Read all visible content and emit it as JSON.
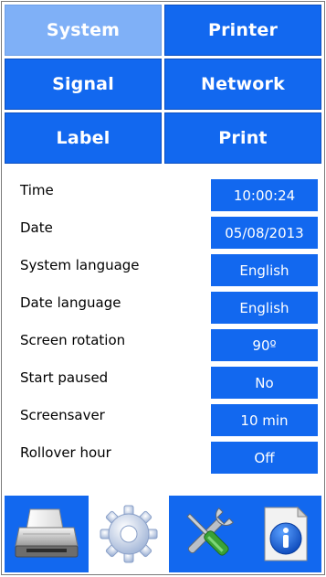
{
  "categories": [
    {
      "label": "System",
      "active": true
    },
    {
      "label": "Printer",
      "active": false
    },
    {
      "label": "Signal",
      "active": false
    },
    {
      "label": "Network",
      "active": false
    },
    {
      "label": "Label",
      "active": false
    },
    {
      "label": "Print",
      "active": false
    }
  ],
  "settings": [
    {
      "label": "Time",
      "value": "10:00:24"
    },
    {
      "label": "Date",
      "value": "05/08/2013"
    },
    {
      "label": "System language",
      "value": "English"
    },
    {
      "label": "Date language",
      "value": "English"
    },
    {
      "label": "Screen rotation",
      "value": "90º"
    },
    {
      "label": "Start paused",
      "value": "No"
    },
    {
      "label": "Screensaver",
      "value": "10 min"
    },
    {
      "label": "Rollover hour",
      "value": "Off"
    }
  ],
  "tabs": [
    {
      "icon": "printer-icon",
      "active": false
    },
    {
      "icon": "gear-icon",
      "active": true
    },
    {
      "icon": "tools-icon",
      "active": false
    },
    {
      "icon": "info-icon",
      "active": false
    }
  ],
  "colors": {
    "button_blue": "#1268ef",
    "button_active": "#7fb0f7",
    "text_white": "#ffffff"
  }
}
